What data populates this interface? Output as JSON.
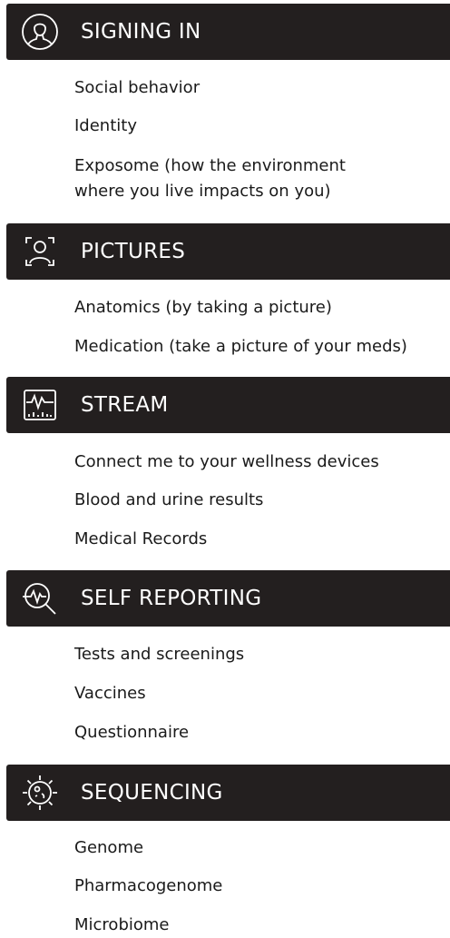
{
  "sections": [
    {
      "title": "SIGNING IN",
      "icon": "person-circle-icon",
      "items": [
        {
          "label": "Social behavior"
        },
        {
          "label": "Identity"
        },
        {
          "label": "Exposome (how the environment",
          "label2": "where you live impacts on you)"
        }
      ]
    },
    {
      "title": "PICTURES",
      "icon": "face-scan-icon",
      "items": [
        {
          "label": "Anatomics (by taking a picture)"
        },
        {
          "label": "Medication (take a picture of your meds)"
        }
      ]
    },
    {
      "title": "STREAM",
      "icon": "heart-rate-monitor-icon",
      "items": [
        {
          "label": "Connect me to your wellness devices"
        },
        {
          "label": "Blood and urine results"
        },
        {
          "label": "Medical Records"
        }
      ]
    },
    {
      "title": "SELF REPORTING",
      "icon": "magnifier-pulse-icon",
      "items": [
        {
          "label": "Tests and screenings"
        },
        {
          "label": "Vaccines"
        },
        {
          "label": "Questionnaire"
        }
      ]
    },
    {
      "title": "SEQUENCING",
      "icon": "cell-target-icon",
      "items": [
        {
          "label": "Genome"
        },
        {
          "label": "Pharmacogenome"
        },
        {
          "label": "Microbiome"
        }
      ]
    }
  ],
  "colors": {
    "header_bg": "#231f1f",
    "header_text": "#ffffff",
    "item_text": "#1a1a1a"
  }
}
